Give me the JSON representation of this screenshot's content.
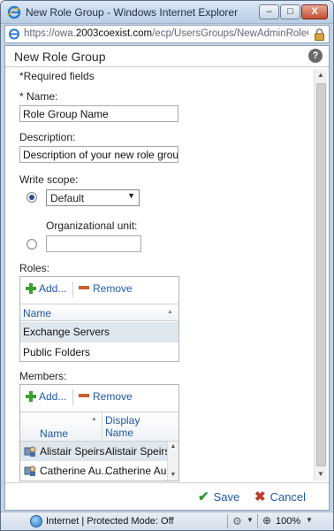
{
  "window": {
    "title": "New Role Group - Windows Internet Explorer",
    "min_label": "–",
    "max_label": "□",
    "close_label": "X"
  },
  "address": {
    "url_prefix": "https://owa.",
    "url_domain": "2003coexist.com",
    "url_path": "/ecp/UsersGroups/NewAdminRoleGroup.asp"
  },
  "dialog": {
    "title": "New Role Group",
    "help": "?",
    "required_note": "*Required fields",
    "name_label": "* Name:",
    "name_value": "Role Group Name",
    "description_label": "Description:",
    "description_value": "Description of your new role group",
    "write_scope_label": "Write scope:",
    "scope_default": "Default",
    "org_unit_label": "Organizational unit:",
    "org_unit_value": ""
  },
  "roles": {
    "label": "Roles:",
    "add_label": "Add...",
    "remove_label": "Remove",
    "column_name": "Name",
    "rows": [
      "Exchange Servers",
      "Public Folders"
    ]
  },
  "members": {
    "label": "Members:",
    "add_label": "Add...",
    "remove_label": "Remove",
    "column_name": "Name",
    "column_display_1": "Display",
    "column_display_2": "Name",
    "rows": [
      {
        "name": "Alistair Speirs",
        "display": "Alistair Speirs"
      },
      {
        "name": "Catherine Au...",
        "display": "Catherine Au..."
      }
    ]
  },
  "actions": {
    "save_label": "Save",
    "cancel_label": "Cancel"
  },
  "status": {
    "zone": "Internet | Protected Mode: Off",
    "zoom": "100%"
  },
  "colors": {
    "link": "#1e5aa8",
    "selected_row": "#dfe7ee",
    "save_check": "#2f9a2f",
    "cancel_x": "#c0392b"
  }
}
